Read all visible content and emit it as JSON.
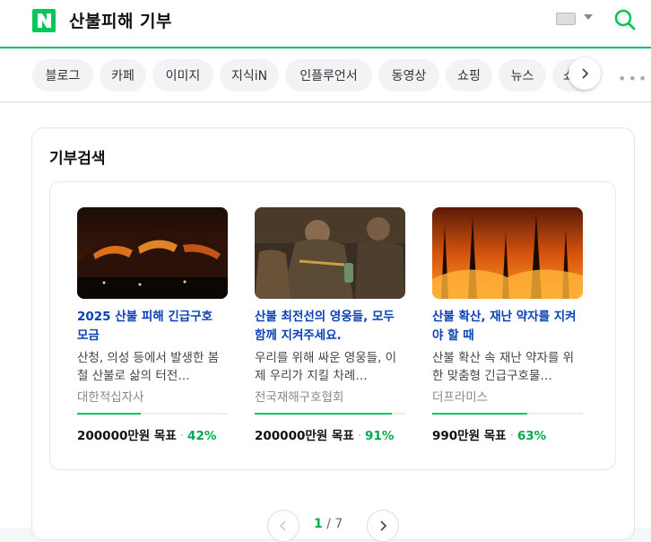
{
  "header": {
    "logo_letter": "N",
    "query": "산불피해 기부"
  },
  "tabs": [
    {
      "label": "블로그"
    },
    {
      "label": "카페"
    },
    {
      "label": "이미지"
    },
    {
      "label": "지식iN"
    },
    {
      "label": "인플루언서"
    },
    {
      "label": "동영상"
    },
    {
      "label": "쇼핑"
    },
    {
      "label": "뉴스"
    },
    {
      "label": "쇼"
    }
  ],
  "section": {
    "title": "기부검색",
    "cards": [
      {
        "title": "2025 산불 피해 긴급구호 모금",
        "desc": "산청, 의성 등에서 발생한 봄철 산불로 삶의 터전…",
        "org": "대한적십자사",
        "goal": "200000만원 목표",
        "percent_label": "42%",
        "progress": 0.42
      },
      {
        "title": "산불 최전선의 영웅들, 모두 함께 지켜주세요.",
        "desc": "우리를 위해 싸운 영웅들, 이제 우리가 지킬 차례…",
        "org": "전국재해구호협회",
        "goal": "200000만원 목표",
        "percent_label": "91%",
        "progress": 0.91
      },
      {
        "title": "산불 확산, 재난 약자를 지켜야 할 때",
        "desc": "산불 확산 속 재난 약자를 위한 맞춤형 긴급구호물…",
        "org": "더프라미스",
        "goal": "990만원 목표",
        "percent_label": "63%",
        "progress": 0.63
      }
    ],
    "pagination": {
      "current": "1",
      "separator": "/",
      "total": "7"
    }
  },
  "colors": {
    "brand": "#03c75a",
    "title_link": "#0b42b5",
    "percent": "#03a94e"
  }
}
